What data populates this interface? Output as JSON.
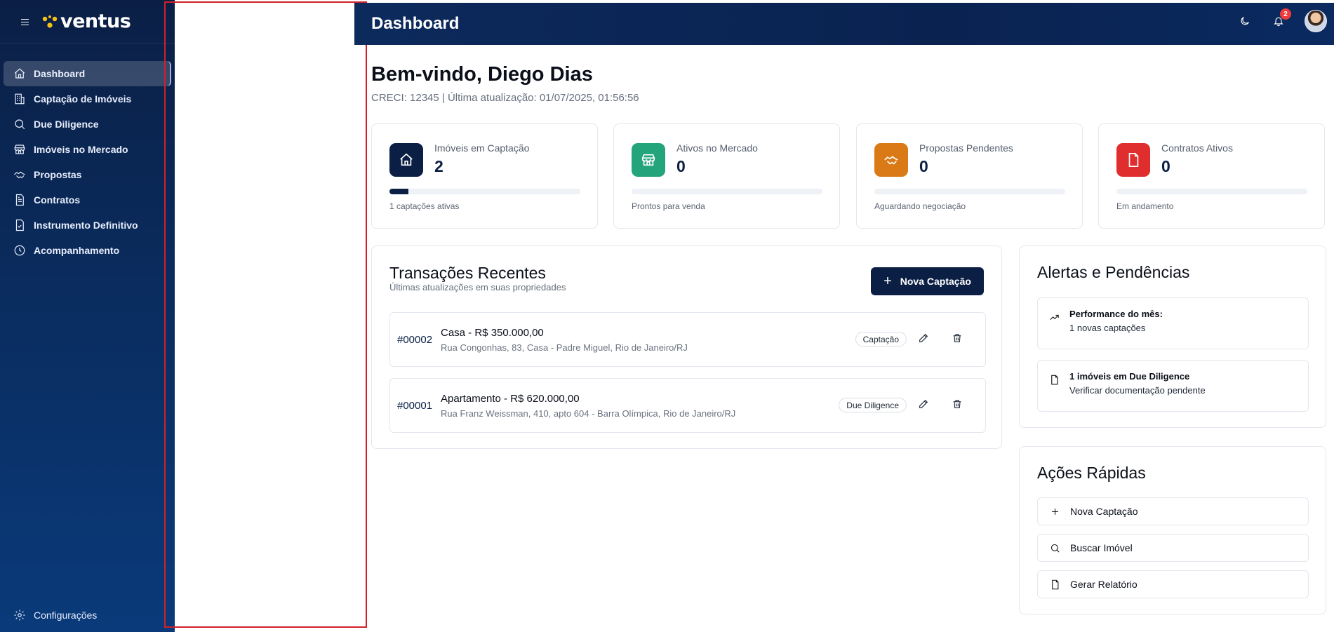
{
  "app": {
    "brand": "ventus",
    "brand_accent": "#f6c21a",
    "accent": "#0b1f45"
  },
  "sidebar": {
    "items": [
      {
        "label": "Dashboard",
        "icon": "home-icon",
        "active": true
      },
      {
        "label": "Captação de Imóveis",
        "icon": "building-icon"
      },
      {
        "label": "Due Diligence",
        "icon": "search-icon"
      },
      {
        "label": "Imóveis no Mercado",
        "icon": "store-icon"
      },
      {
        "label": "Propostas",
        "icon": "handshake-icon"
      },
      {
        "label": "Contratos",
        "icon": "document-icon"
      },
      {
        "label": "Instrumento Definitivo",
        "icon": "file-check-icon"
      },
      {
        "label": "Acompanhamento",
        "icon": "clock-icon"
      }
    ],
    "footer": {
      "label": "Configurações",
      "icon": "gear-icon"
    }
  },
  "header": {
    "title": "Dashboard",
    "notifications": "2"
  },
  "welcome": {
    "title": "Bem-vindo, Diego Dias",
    "subtitle": "CRECI: 12345 | Última atualização: 01/07/2025, 01:56:56"
  },
  "stats": [
    {
      "label": "Imóveis em Captação",
      "value": "2",
      "note": "1 captações ativas",
      "color": "#0b1f45",
      "icon": "home-icon",
      "progress": 0.1
    },
    {
      "label": "Ativos no Mercado",
      "value": "0",
      "note": "Prontos para venda",
      "color": "#23a47a",
      "icon": "store-icon",
      "progress": 0
    },
    {
      "label": "Propostas Pendentes",
      "value": "0",
      "note": "Aguardando negociação",
      "color": "#d97a16",
      "icon": "handshake-icon",
      "progress": 0
    },
    {
      "label": "Contratos Ativos",
      "value": "0",
      "note": "Em andamento",
      "color": "#e02d2d",
      "icon": "document-icon",
      "progress": 0
    }
  ],
  "transactions": {
    "title": "Transações Recentes",
    "subtitle": "Últimas atualizações em suas propriedades",
    "new_button": "Nova Captação",
    "rows": [
      {
        "id": "#00002",
        "name": "Casa - R$ 350.000,00",
        "address": "Rua Congonhas, 83, Casa - Padre Miguel, Rio de Janeiro/RJ",
        "status": "Captação"
      },
      {
        "id": "#00001",
        "name": "Apartamento - R$ 620.000,00",
        "address": "Rua Franz Weissman, 410, apto 604 - Barra Olímpica, Rio de Janeiro/RJ",
        "status": "Due Diligence"
      }
    ]
  },
  "alerts": {
    "title": "Alertas e Pendências",
    "items": [
      {
        "title": "Performance do mês:",
        "desc": "1 novas captações",
        "icon": "trend-up-icon"
      },
      {
        "title": "1 imóveis em Due Diligence",
        "desc": "Verificar documentação pendente",
        "icon": "document-icon"
      }
    ]
  },
  "quick_actions": {
    "title": "Ações Rápidas",
    "items": [
      {
        "label": "Nova Captação",
        "icon": "plus-icon"
      },
      {
        "label": "Buscar Imóvel",
        "icon": "search-icon"
      },
      {
        "label": "Gerar Relatório",
        "icon": "document-icon"
      }
    ]
  }
}
